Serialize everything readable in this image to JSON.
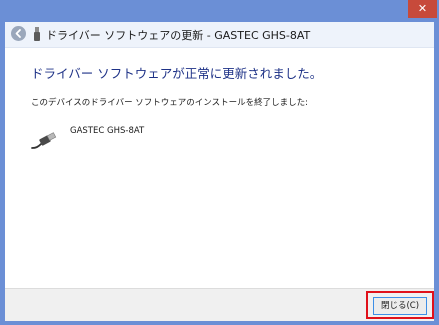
{
  "window": {
    "close_glyph": "✕",
    "accent": "#6b8fd6"
  },
  "header": {
    "title": "ドライバー ソフトウェアの更新 - GASTEC GHS-8AT",
    "back_icon": "back-arrow-icon",
    "device_icon": "usb-icon"
  },
  "main": {
    "heading": "ドライバー ソフトウェアが正常に更新されました。",
    "description": "このデバイスのドライバー ソフトウェアのインストールを終了しました:",
    "device_name": "GASTEC GHS-8AT",
    "device_icon": "usb-cable-icon"
  },
  "footer": {
    "close_label": "閉じる(C)",
    "highlight_color": "#e0101a"
  }
}
